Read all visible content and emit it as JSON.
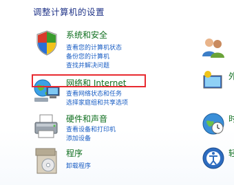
{
  "window": {
    "title": "调整计算机的设置"
  },
  "categories": [
    {
      "title": "系统和安全",
      "links": [
        "查看您的计算机状态",
        "备份您的计算机",
        "查找并解决问题"
      ]
    },
    {
      "title": "网络和 Internet",
      "links": [
        "查看网络状态和任务",
        "选择家庭组和共享选项"
      ]
    },
    {
      "title": "硬件和声音",
      "links": [
        "查看设备和打印机",
        "添加设备"
      ]
    },
    {
      "title": "程序",
      "links": [
        "卸载程序"
      ]
    }
  ],
  "right_column": [
    {
      "label": ""
    },
    {
      "label": "外"
    },
    {
      "label": "时"
    },
    {
      "label": "轻"
    }
  ],
  "highlight": {
    "target": "网络和 Internet",
    "color": "#e8292f"
  },
  "colors": {
    "category_title": "#0e6e1e",
    "link": "#1a5ec4",
    "page_title": "#1e3287"
  }
}
